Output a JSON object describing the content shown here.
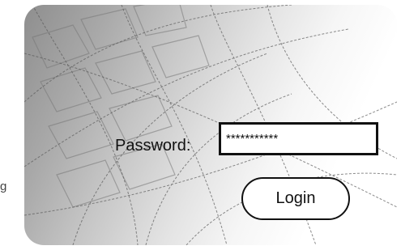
{
  "side_fragment": "g",
  "login_form": {
    "password_label": "Password:",
    "password_value": "***********",
    "login_button_label": "Login"
  },
  "background": {
    "image": "keyboard-photo-with-curve-lines"
  }
}
